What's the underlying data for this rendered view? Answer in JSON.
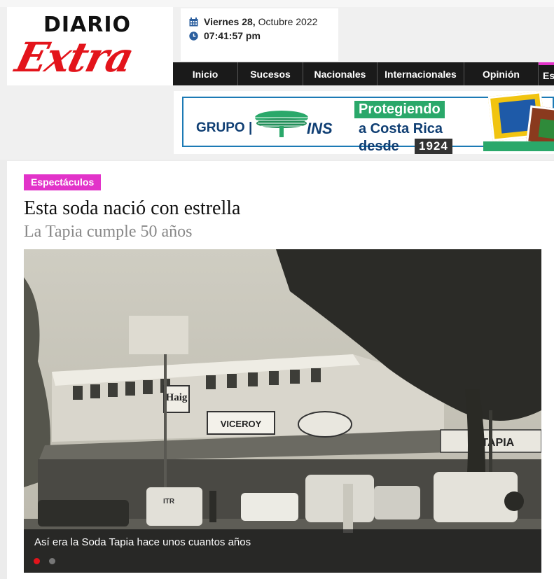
{
  "logo": {
    "line1": "DIARIO",
    "line2": "Extra"
  },
  "datetime": {
    "weekday_day": "Viernes 28,",
    "month_year": " Octubre 2022",
    "time": "07:41:57 pm"
  },
  "nav": {
    "items": [
      "Inicio",
      "Sucesos",
      "Nacionales",
      "Internacionales",
      "Opinión",
      "Es"
    ]
  },
  "banner": {
    "group": "GRUPO |",
    "brand": "INS",
    "headline": "Protegiendo",
    "line2": "a Costa Rica",
    "line3": "desde",
    "year": "1924"
  },
  "article": {
    "category": "Espectáculos",
    "title": "Esta soda nació con estrella",
    "subtitle": "La Tapia cumple 50 años",
    "photo": {
      "caption": "Así era la Soda Tapia hace unos cuantos años",
      "signs": {
        "haig": "Haig",
        "viceroy": "VICEROY",
        "tapia": "S  TAPIA",
        "itr": "ITR"
      }
    }
  },
  "colors": {
    "brand_red": "#e3141b",
    "nav_bg": "#1a1a1a",
    "category_pink": "#e233c9",
    "ins_blue": "#0f3e73",
    "ins_green": "#2aa86a",
    "slider_active": "#e3141b"
  },
  "icons": {
    "calendar": "calendar-icon",
    "clock": "clock-icon"
  }
}
